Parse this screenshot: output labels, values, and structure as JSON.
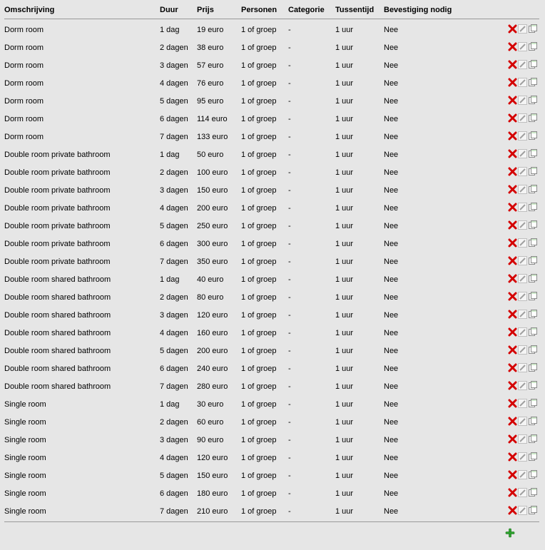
{
  "headers": {
    "omschrijving": "Omschrijving",
    "duur": "Duur",
    "prijs": "Prijs",
    "personen": "Personen",
    "categorie": "Categorie",
    "tussentijd": "Tussentijd",
    "bevestiging": "Bevestiging nodig"
  },
  "rows": [
    {
      "omschrijving": "Dorm room",
      "duur": "1 dag",
      "prijs": "19 euro",
      "personen": "1 of groep",
      "categorie": "-",
      "tussentijd": "1 uur",
      "bevestiging": "Nee"
    },
    {
      "omschrijving": "Dorm room",
      "duur": "2 dagen",
      "prijs": "38 euro",
      "personen": "1 of groep",
      "categorie": "-",
      "tussentijd": "1 uur",
      "bevestiging": "Nee"
    },
    {
      "omschrijving": "Dorm room",
      "duur": "3 dagen",
      "prijs": "57 euro",
      "personen": "1 of groep",
      "categorie": "-",
      "tussentijd": "1 uur",
      "bevestiging": "Nee"
    },
    {
      "omschrijving": "Dorm room",
      "duur": "4 dagen",
      "prijs": "76 euro",
      "personen": "1 of groep",
      "categorie": "-",
      "tussentijd": "1 uur",
      "bevestiging": "Nee"
    },
    {
      "omschrijving": "Dorm room",
      "duur": "5 dagen",
      "prijs": "95 euro",
      "personen": "1 of groep",
      "categorie": "-",
      "tussentijd": "1 uur",
      "bevestiging": "Nee"
    },
    {
      "omschrijving": "Dorm room",
      "duur": "6 dagen",
      "prijs": "114 euro",
      "personen": "1 of groep",
      "categorie": "-",
      "tussentijd": "1 uur",
      "bevestiging": "Nee"
    },
    {
      "omschrijving": "Dorm room",
      "duur": "7 dagen",
      "prijs": "133 euro",
      "personen": "1 of groep",
      "categorie": "-",
      "tussentijd": "1 uur",
      "bevestiging": "Nee"
    },
    {
      "omschrijving": "Double room private bathroom",
      "duur": "1 dag",
      "prijs": "50 euro",
      "personen": "1 of groep",
      "categorie": "-",
      "tussentijd": "1 uur",
      "bevestiging": "Nee"
    },
    {
      "omschrijving": "Double room private bathroom",
      "duur": "2 dagen",
      "prijs": "100 euro",
      "personen": "1 of groep",
      "categorie": "-",
      "tussentijd": "1 uur",
      "bevestiging": "Nee"
    },
    {
      "omschrijving": "Double room private bathroom",
      "duur": "3 dagen",
      "prijs": "150 euro",
      "personen": "1 of groep",
      "categorie": "-",
      "tussentijd": "1 uur",
      "bevestiging": "Nee"
    },
    {
      "omschrijving": "Double room private bathroom",
      "duur": "4 dagen",
      "prijs": "200 euro",
      "personen": "1 of groep",
      "categorie": "-",
      "tussentijd": "1 uur",
      "bevestiging": "Nee"
    },
    {
      "omschrijving": "Double room private bathroom",
      "duur": "5 dagen",
      "prijs": "250 euro",
      "personen": "1 of groep",
      "categorie": "-",
      "tussentijd": "1 uur",
      "bevestiging": "Nee"
    },
    {
      "omschrijving": "Double room private bathroom",
      "duur": "6 dagen",
      "prijs": "300 euro",
      "personen": "1 of groep",
      "categorie": "-",
      "tussentijd": "1 uur",
      "bevestiging": "Nee"
    },
    {
      "omschrijving": "Double room private bathroom",
      "duur": "7 dagen",
      "prijs": "350 euro",
      "personen": "1 of groep",
      "categorie": "-",
      "tussentijd": "1 uur",
      "bevestiging": "Nee"
    },
    {
      "omschrijving": "Double room shared bathroom",
      "duur": "1 dag",
      "prijs": "40 euro",
      "personen": "1 of groep",
      "categorie": "-",
      "tussentijd": "1 uur",
      "bevestiging": "Nee"
    },
    {
      "omschrijving": "Double room shared bathroom",
      "duur": "2 dagen",
      "prijs": "80 euro",
      "personen": "1 of groep",
      "categorie": "-",
      "tussentijd": "1 uur",
      "bevestiging": "Nee"
    },
    {
      "omschrijving": "Double room shared bathroom",
      "duur": "3 dagen",
      "prijs": "120 euro",
      "personen": "1 of groep",
      "categorie": "-",
      "tussentijd": "1 uur",
      "bevestiging": "Nee"
    },
    {
      "omschrijving": "Double room shared bathroom",
      "duur": "4 dagen",
      "prijs": "160 euro",
      "personen": "1 of groep",
      "categorie": "-",
      "tussentijd": "1 uur",
      "bevestiging": "Nee"
    },
    {
      "omschrijving": "Double room shared bathroom",
      "duur": "5 dagen",
      "prijs": "200 euro",
      "personen": "1 of groep",
      "categorie": "-",
      "tussentijd": "1 uur",
      "bevestiging": "Nee"
    },
    {
      "omschrijving": "Double room shared bathroom",
      "duur": "6 dagen",
      "prijs": "240 euro",
      "personen": "1 of groep",
      "categorie": "-",
      "tussentijd": "1 uur",
      "bevestiging": "Nee"
    },
    {
      "omschrijving": "Double room shared bathroom",
      "duur": "7 dagen",
      "prijs": "280 euro",
      "personen": "1 of groep",
      "categorie": "-",
      "tussentijd": "1 uur",
      "bevestiging": "Nee"
    },
    {
      "omschrijving": "Single room",
      "duur": "1 dag",
      "prijs": "30 euro",
      "personen": "1 of groep",
      "categorie": "-",
      "tussentijd": "1 uur",
      "bevestiging": "Nee"
    },
    {
      "omschrijving": "Single room",
      "duur": "2 dagen",
      "prijs": "60 euro",
      "personen": "1 of groep",
      "categorie": "-",
      "tussentijd": "1 uur",
      "bevestiging": "Nee"
    },
    {
      "omschrijving": "Single room",
      "duur": "3 dagen",
      "prijs": "90 euro",
      "personen": "1 of groep",
      "categorie": "-",
      "tussentijd": "1 uur",
      "bevestiging": "Nee"
    },
    {
      "omschrijving": "Single room",
      "duur": "4 dagen",
      "prijs": "120 euro",
      "personen": "1 of groep",
      "categorie": "-",
      "tussentijd": "1 uur",
      "bevestiging": "Nee"
    },
    {
      "omschrijving": "Single room",
      "duur": "5 dagen",
      "prijs": "150 euro",
      "personen": "1 of groep",
      "categorie": "-",
      "tussentijd": "1 uur",
      "bevestiging": "Nee"
    },
    {
      "omschrijving": "Single room",
      "duur": "6 dagen",
      "prijs": "180 euro",
      "personen": "1 of groep",
      "categorie": "-",
      "tussentijd": "1 uur",
      "bevestiging": "Nee"
    },
    {
      "omschrijving": "Single room",
      "duur": "7 dagen",
      "prijs": "210 euro",
      "personen": "1 of groep",
      "categorie": "-",
      "tussentijd": "1 uur",
      "bevestiging": "Nee"
    }
  ]
}
